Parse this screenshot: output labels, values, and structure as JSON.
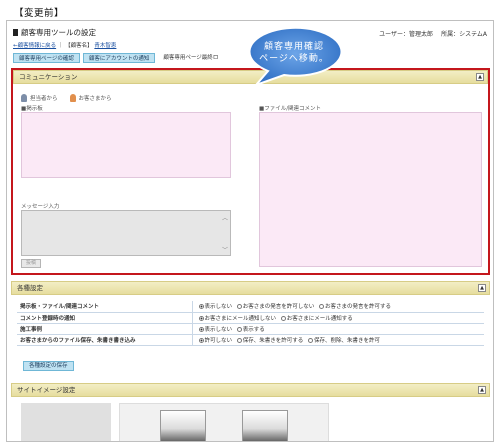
{
  "caption": "【変更前】",
  "header": {
    "title": "顧客専用ツールの設定",
    "user_label": "ユーザー：管理太郎",
    "org_label": "所属：システムA"
  },
  "breadcrumb": {
    "back_link": "←顧客情報に戻る",
    "separator": "｜",
    "customer_label": "【顧客名】",
    "customer_name": "青木智恵"
  },
  "tabs": [
    {
      "label": "顧客専用ページの確認"
    },
    {
      "label": "顧客にアカウントの通知"
    },
    {
      "label": "顧客専用ページ最終ロ"
    }
  ],
  "callout": {
    "line1": "顧客専用確認",
    "line2": "ページへ移動。"
  },
  "communication": {
    "title": "コミュニケーション",
    "toggle": "▲",
    "role_staff": "担当者から",
    "role_customer": "お客さまから",
    "board_label": "■掲示板",
    "file_label": "■ファイル/関連コメント",
    "message_label": "メッセージ入力",
    "scroll_up": "︿",
    "scroll_down": "﹀",
    "post_button": "投稿"
  },
  "settings": {
    "title": "各種設定",
    "toggle": "▲",
    "rows": [
      {
        "key": "掲示板・ファイル/関連コメント",
        "options": [
          "表示しない",
          "お客さまの発言を許可しない",
          "お客さまの発言を許可する"
        ],
        "selected": 0
      },
      {
        "key": "コメント登録時の通知",
        "options": [
          "お客さまにメール通知しない",
          "お客さまにメール通知する"
        ],
        "selected": 0
      },
      {
        "key": "施工事例",
        "options": [
          "表示しない",
          "表示する"
        ],
        "selected": 0
      },
      {
        "key": "お客さまからのファイル保存、朱書き書き込み",
        "options": [
          "許可しない",
          "保存、朱書きを許可する",
          "保存、削除、朱書きを許可"
        ],
        "selected": 0
      }
    ],
    "save_button": "各種設定の保存"
  },
  "site_image": {
    "title": "サイトイメージ設定",
    "toggle": "▲"
  },
  "colors": {
    "accent_red": "#c4161c",
    "callout_blue": "#3f7fd0",
    "section_yellow": "#ebe3a8",
    "board_pink": "#fbe9f6"
  }
}
